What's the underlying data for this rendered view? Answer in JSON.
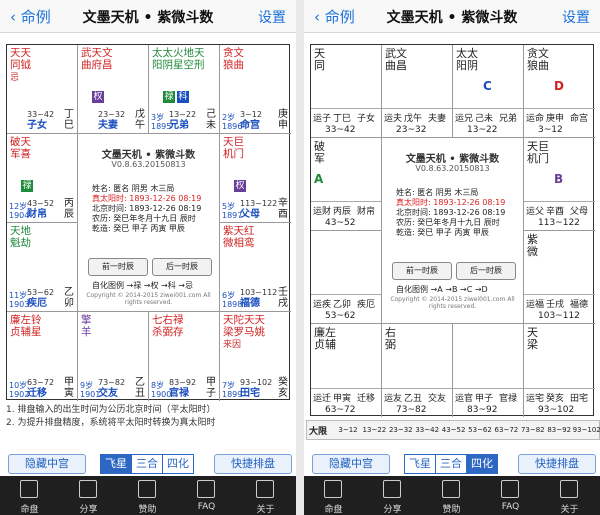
{
  "nav": {
    "back": "命例",
    "title": "文墨天机 • 紫微斗数",
    "settings": "设置"
  },
  "colors": {
    "accent": "#1e73d8",
    "red": "#d22222",
    "green": "#1f8a3a",
    "purple": "#6a3d9a",
    "blue": "#1a4fbf"
  },
  "left_chart": {
    "palaces": [
      {
        "stars": "天天\n同钺",
        "aux": "忌",
        "mark": "",
        "age": "",
        "range": "33~42",
        "palace": "子女",
        "gz": "丁\n巳"
      },
      {
        "stars": "武天文\n曲府昌",
        "aux": "",
        "mark": "权",
        "age": "",
        "range": "23~32",
        "palace": "夫妻",
        "gz": "戊\n午"
      },
      {
        "stars": "太太火地天\n阳阴星空刑",
        "aux": "",
        "mark": "禄 科",
        "age": "3岁\n1895",
        "range": "13~22",
        "palace": "兄弟",
        "gz": "己\n未"
      },
      {
        "stars": "贪文\n狼曲",
        "aux": "",
        "mark": "",
        "age": "2岁\n1896",
        "range": "3~12",
        "palace": "命宫",
        "gz": "庚\n申"
      },
      {
        "stars": "破天\n军喜",
        "aux": "",
        "mark": "禄",
        "age": "12岁\n1904",
        "range": "43~52",
        "palace": "财帛",
        "gz": "丙\n辰"
      },
      {
        "stars": "天巨\n机门",
        "aux": "",
        "mark": "权",
        "age": "5岁\n1897",
        "range": "113~122",
        "palace": "父母",
        "gz": "辛\n酉"
      },
      {
        "stars": "天地\n魁劫",
        "aux": "",
        "mark": "",
        "age": "11岁\n1903",
        "range": "53~62",
        "palace": "疾厄",
        "gz": "乙\n卯"
      },
      {
        "stars": "紫天红\n微相鸾",
        "aux": "",
        "mark": "",
        "age": "6岁\n1898",
        "range": "103~112",
        "palace": "福德",
        "gz": "壬\n戌"
      },
      {
        "stars": "廉左铃\n贞辅星",
        "aux": "",
        "mark": "",
        "age": "10岁\n1902",
        "range": "63~72",
        "palace": "迁移",
        "gz": "甲\n寅"
      },
      {
        "stars": "擎\n羊",
        "aux": "",
        "mark": "",
        "age": "9岁\n1901",
        "range": "73~82",
        "palace": "交友",
        "gz": "乙\n丑"
      },
      {
        "stars": "七右禄\n杀弼存",
        "aux": "",
        "mark": "",
        "age": "8岁\n1900",
        "range": "83~92",
        "palace": "官禄",
        "gz": "甲\n子"
      },
      {
        "stars": "天陀天天\n梁罗马姚",
        "aux": "来因",
        "mark": "",
        "age": "7岁\n1899",
        "range": "93~102",
        "palace": "田宅",
        "gz": "癸\n亥"
      }
    ],
    "center": {
      "title": "文墨天机 • 紫微斗数",
      "version": "V0.8.63.20150813",
      "lines": [
        "姓名: 匿名      阴男 木三局",
        "真太阳时: 1893-12-26 08:19",
        "北京时间: 1893-12-26 08:19",
        "农历: 癸巳年冬月十九日 辰时",
        "乾造: 癸巳 甲子 丙寅 甲辰"
      ],
      "prev_btn": "前一时辰",
      "next_btn": "后一时辰",
      "legend": "自化图例 →禄 →权 →科 →忌",
      "copyright": "Copyright © 2014-2015 ziwei001.com All rights reserved."
    }
  },
  "notes": [
    "1. 排盘输入的出生时间为公历北京时间（平太阳时）",
    "2. 为提升排盘精度，系统将平太阳时转换为真太阳时"
  ],
  "buttons": {
    "hide": "隐藏中宫",
    "fly": "飞星",
    "sanhe": "三合",
    "sihua": "四化",
    "quick": "快捷排盘"
  },
  "tabs": [
    "命盘",
    "分享",
    "赞助",
    "FAQ",
    "关于"
  ],
  "right_chart": {
    "cells": [
      {
        "main": "天\n同",
        "hua": "",
        "sub": [
          "运子",
          "丁巳",
          "子女",
          "33~42"
        ]
      },
      {
        "main": "武文\n曲昌",
        "hua": "",
        "sub": [
          "运夫",
          "戊午",
          "夫妻",
          "23~32"
        ]
      },
      {
        "main": "太太\n阳阴",
        "hua": "C",
        "sub": [
          "运兄",
          "己未",
          "兄弟",
          "13~22"
        ]
      },
      {
        "main": "贪文\n狼曲",
        "hua": "D",
        "sub": [
          "运命",
          "庚申",
          "命宫",
          "3~12"
        ]
      },
      {
        "main": "破\n军",
        "hua": "A",
        "sub": [
          "运财",
          "丙辰",
          "财帛",
          "43~52"
        ]
      },
      {
        "main": "天巨\n机门",
        "hua": "B",
        "sub": [
          "运父",
          "辛酉",
          "父母",
          "113~122"
        ]
      },
      {
        "main": "",
        "hua": "",
        "sub": [
          "运疾",
          "乙卯",
          "疾厄",
          "53~62"
        ]
      },
      {
        "main": "紫\n微",
        "hua": "",
        "sub": [
          "运福",
          "壬戌",
          "福德",
          "103~112"
        ]
      },
      {
        "main": "廉左\n贞辅",
        "hua": "",
        "sub": [
          "运迁",
          "甲寅",
          "迁移",
          "63~72"
        ]
      },
      {
        "main": "右\n弼",
        "hua": "",
        "sub": [
          "运友",
          "乙丑",
          "交友",
          "73~82"
        ]
      },
      {
        "main": "",
        "hua": "",
        "sub": [
          "运官",
          "甲子",
          "官禄",
          "83~92"
        ]
      },
      {
        "main": "天\n梁",
        "hua": "",
        "sub": [
          "运宅",
          "癸亥",
          "田宅",
          "93~102"
        ]
      }
    ],
    "center_legend": "自化图例 →A →B →C →D",
    "decade_label": "大限",
    "decades": [
      "3~12",
      "13~22",
      "23~32",
      "33~42",
      "43~52",
      "53~62",
      "63~72",
      "73~82",
      "83~92",
      "93~102"
    ]
  }
}
